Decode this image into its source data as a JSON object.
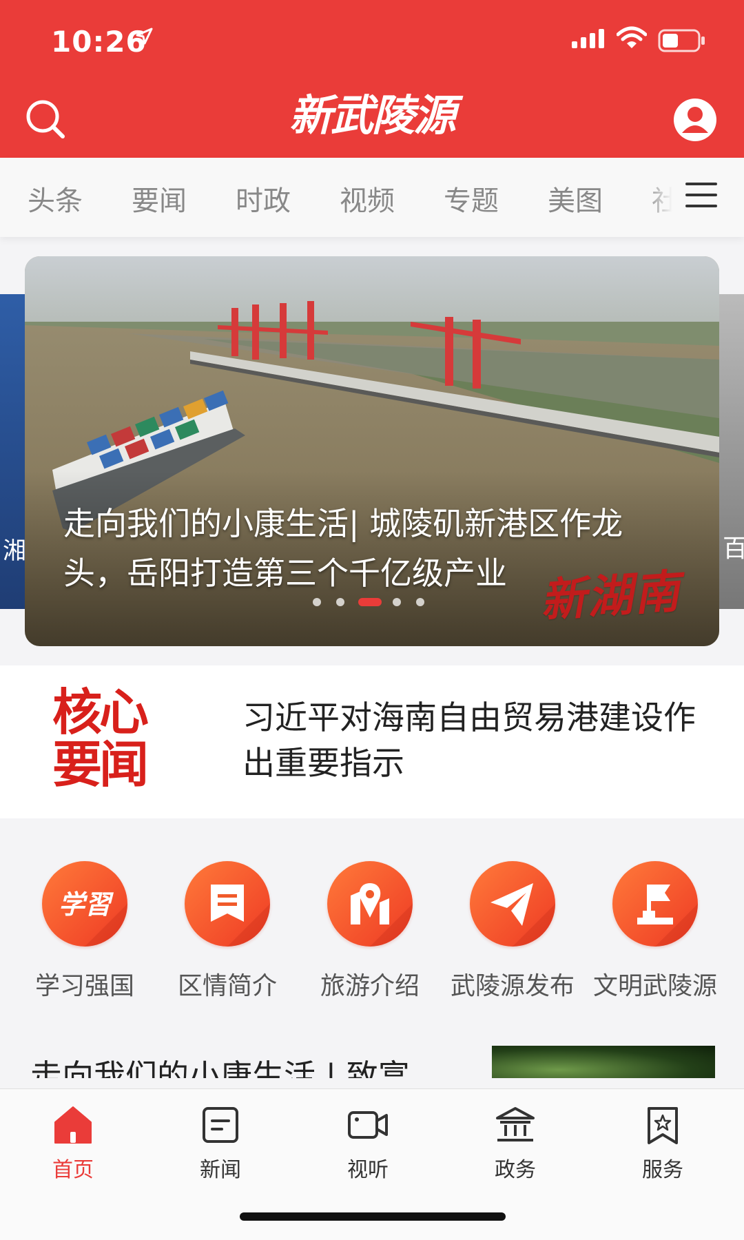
{
  "status_bar": {
    "time": "10:26"
  },
  "header": {
    "logo_text": "新武陵源"
  },
  "tabs": [
    {
      "label": "头条"
    },
    {
      "label": "要闻"
    },
    {
      "label": "时政"
    },
    {
      "label": "视频"
    },
    {
      "label": "专题"
    },
    {
      "label": "美图"
    },
    {
      "label": "社"
    }
  ],
  "carousel": {
    "left_peek_text": "湘",
    "right_peek_text": "百",
    "caption": "走向我们的小康生活| 城陵矶新港区作龙头，岳阳打造第三个千亿级产业",
    "watermark": "新湖南",
    "dots_total": 5,
    "active_index": 2
  },
  "core_news": {
    "badge_line1": "核心",
    "badge_line2": "要闻",
    "headline": "习近平对海南自由贸易港建设作出重要指示"
  },
  "services": [
    {
      "label": "学习强国",
      "icon": "xuexi-icon"
    },
    {
      "label": "区情简介",
      "icon": "message-icon"
    },
    {
      "label": "旅游介绍",
      "icon": "map-pin-icon"
    },
    {
      "label": "武陵源发布",
      "icon": "paper-plane-icon"
    },
    {
      "label": "文明武陵源",
      "icon": "flag-icon"
    }
  ],
  "article_preview": {
    "title": "走向我们的小康生活 | 致富"
  },
  "bottom_nav": [
    {
      "label": "首页",
      "icon": "home-icon"
    },
    {
      "label": "新闻",
      "icon": "news-icon"
    },
    {
      "label": "视听",
      "icon": "video-icon"
    },
    {
      "label": "政务",
      "icon": "government-icon"
    },
    {
      "label": "服务",
      "icon": "service-icon"
    }
  ],
  "colors": {
    "brand_red": "#ea3c39",
    "service_orange": "#f05a2a"
  }
}
